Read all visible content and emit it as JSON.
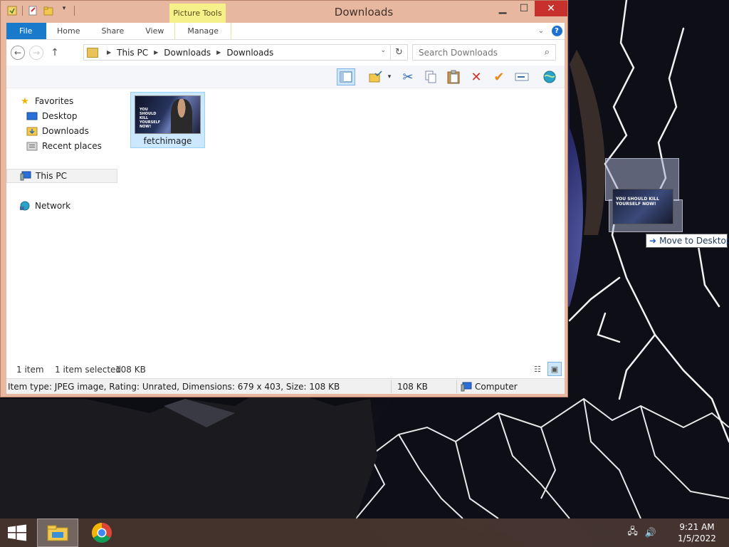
{
  "window": {
    "title": "Downloads",
    "context_tab": "Picture Tools",
    "close_glyph": "✕",
    "minimize_glyph": "▁",
    "maximize_glyph": "☐"
  },
  "ribbon": {
    "tabs": [
      "File",
      "Home",
      "Share",
      "View",
      "Manage"
    ],
    "help": "?"
  },
  "address": {
    "crumbs": [
      "This PC",
      "Downloads",
      "Downloads"
    ],
    "search_placeholder": "Search Downloads"
  },
  "navpane": {
    "favorites": "Favorites",
    "desktop": "Desktop",
    "downloads": "Downloads",
    "recent": "Recent places",
    "thispc": "This PC",
    "network": "Network"
  },
  "files": [
    {
      "name": "fetchimage",
      "thumb_text": "YOU SHOULD KILL YOURSELF NOW!"
    }
  ],
  "status": {
    "item_count": "1 item",
    "selected": "1 item selected",
    "size": "108 KB"
  },
  "details": {
    "info": "Item type: JPEG image, Rating: Unrated, Dimensions: 679 x 403, Size: 108 KB",
    "size": "108 KB",
    "location": "Computer"
  },
  "drag": {
    "tooltip": "Move to Desktop",
    "thumb_text": "YOU SHOULD KILL YOURSELF NOW!"
  },
  "taskbar": {
    "time": "9:21 AM",
    "date": "1/5/2022"
  },
  "colors": {
    "window_frame": "#e8b7a0",
    "file_tab": "#1979ca",
    "context_tab": "#f6f08a",
    "close_button": "#c7302c",
    "selection": "#cce8ff"
  }
}
